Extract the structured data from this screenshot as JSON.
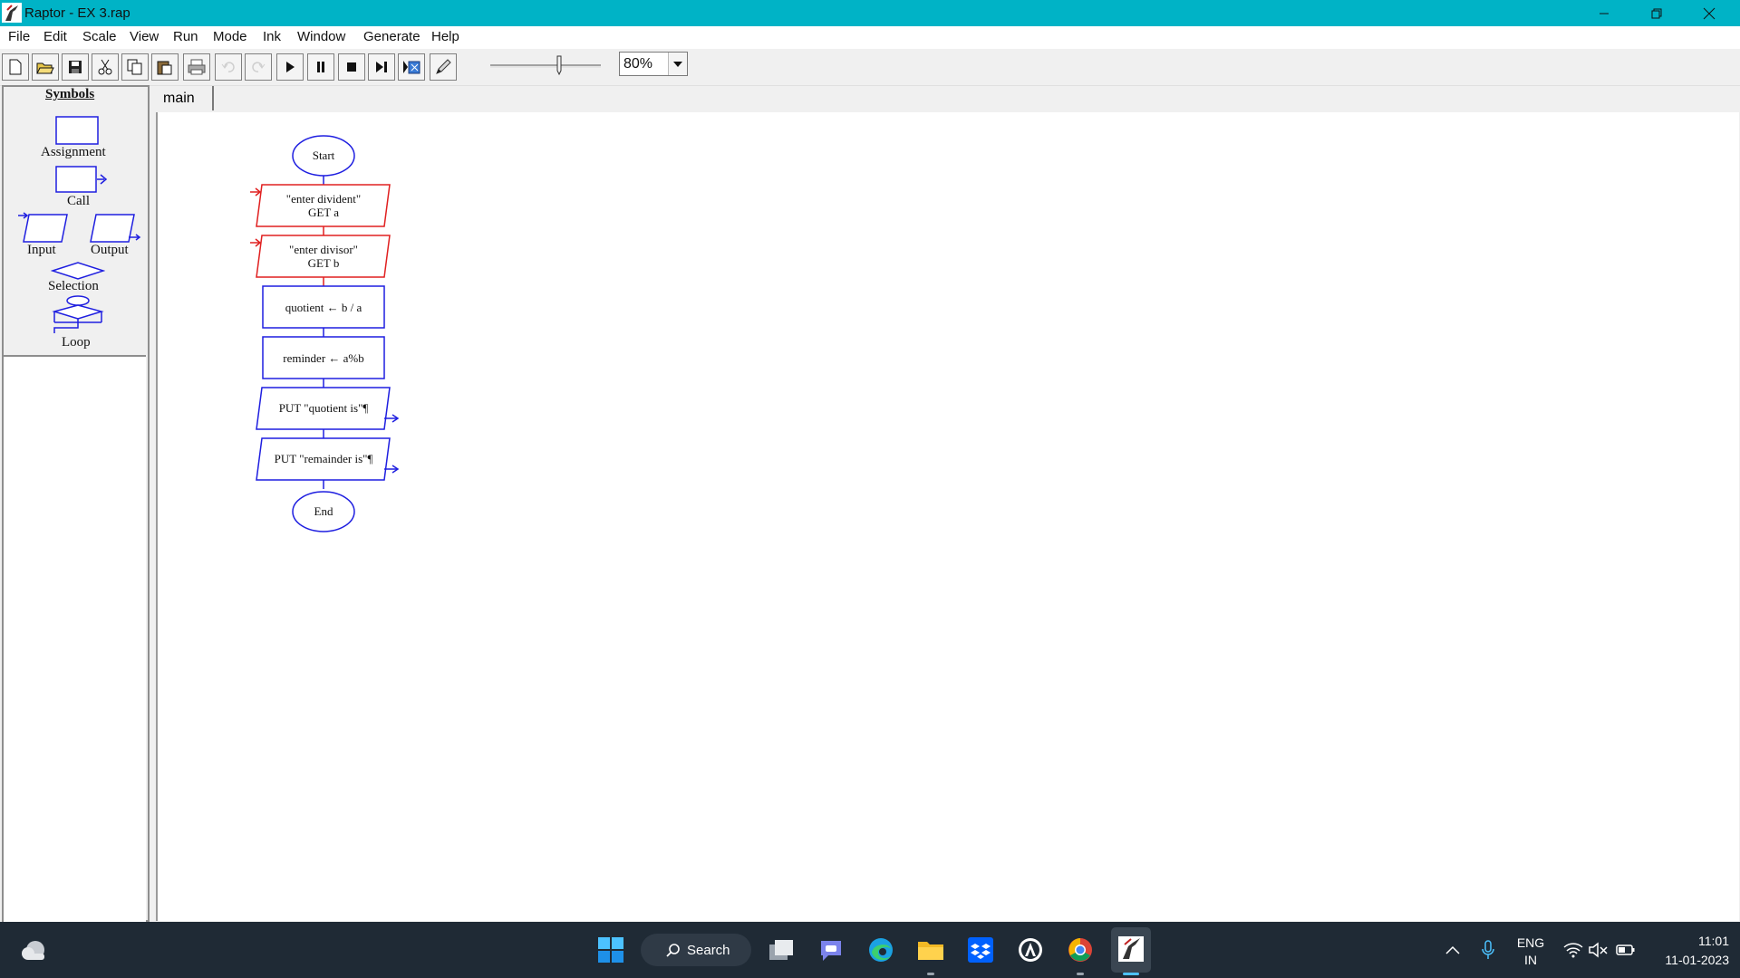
{
  "window": {
    "title": "Raptor - EX 3.rap"
  },
  "menu": [
    "File",
    "Edit",
    "Scale",
    "View",
    "Run",
    "Mode",
    "Ink",
    "Window",
    "Generate",
    "Help"
  ],
  "toolbar": {
    "zoom": "80%"
  },
  "symbols": {
    "heading": "Symbols",
    "assignment": "Assignment",
    "call": "Call",
    "input": "Input",
    "output": "Output",
    "selection": "Selection",
    "loop": "Loop"
  },
  "tabs": [
    "main"
  ],
  "flowchart": {
    "start": "Start",
    "input1_prompt": "\"enter divident\"",
    "input1_get": "GET a",
    "input2_prompt": "\"enter divisor\"",
    "input2_get": "GET b",
    "assign1": "quotient ← b / a",
    "assign2": "reminder ← a%b",
    "output1": "PUT \"quotient  is\"¶",
    "output2": "PUT \"remainder  is\"¶",
    "end": "End"
  },
  "taskbar": {
    "search": "Search",
    "lang1": "ENG",
    "lang2": "IN",
    "time": "11:01",
    "date": "11-01-2023"
  },
  "colors": {
    "titlebar": "#00b3c6",
    "taskbar": "#1f2a35",
    "flow_blue": "#1f1fe0",
    "flow_red": "#e02020"
  }
}
